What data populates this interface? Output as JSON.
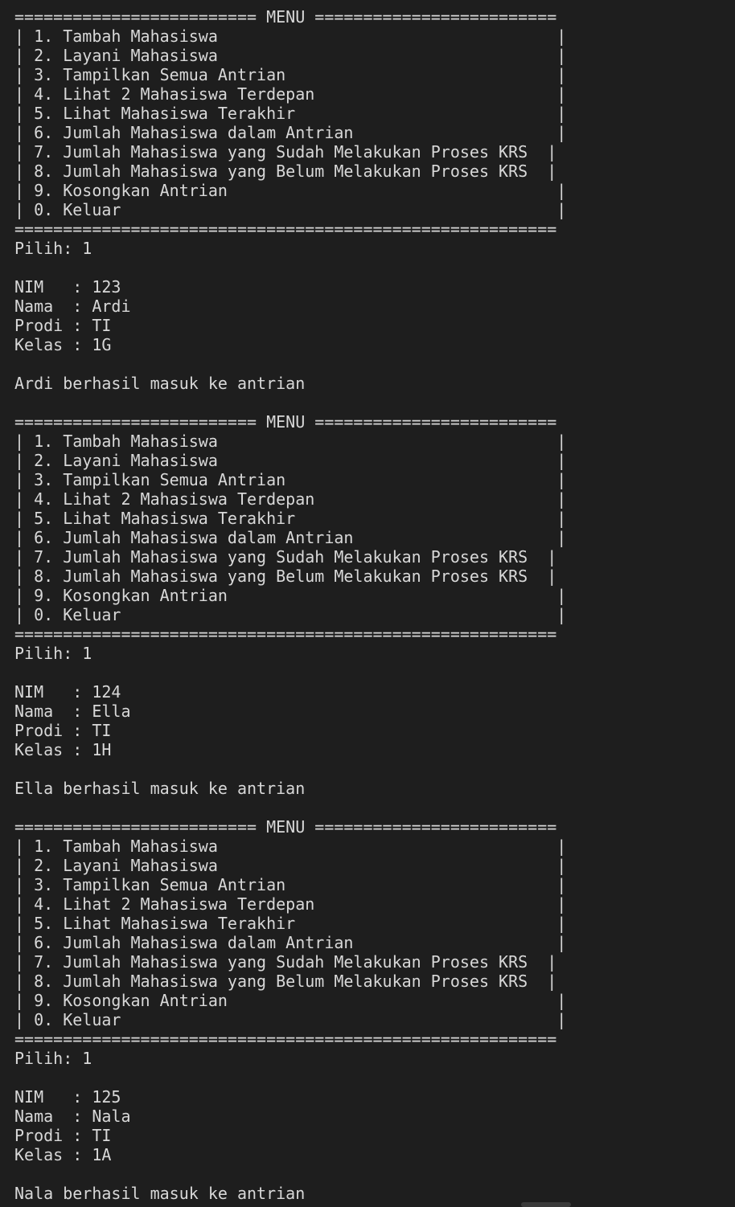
{
  "terminal": {
    "lines": [
      "========================= MENU =========================",
      "| 1. Tambah Mahasiswa                                   |",
      "| 2. Layani Mahasiswa                                   |",
      "| 3. Tampilkan Semua Antrian                            |",
      "| 4. Lihat 2 Mahasiswa Terdepan                         |",
      "| 5. Lihat Mahasiswa Terakhir                           |",
      "| 6. Jumlah Mahasiswa dalam Antrian                     |",
      "| 7. Jumlah Mahasiswa yang Sudah Melakukan Proses KRS  |",
      "| 8. Jumlah Mahasiswa yang Belum Melakukan Proses KRS  |",
      "| 9. Kosongkan Antrian                                  |",
      "| 0. Keluar                                             |",
      "========================================================",
      "Pilih: 1",
      "",
      "NIM   : 123",
      "Nama  : Ardi",
      "Prodi : TI",
      "Kelas : 1G",
      "",
      "Ardi berhasil masuk ke antrian",
      "",
      "========================= MENU =========================",
      "| 1. Tambah Mahasiswa                                   |",
      "| 2. Layani Mahasiswa                                   |",
      "| 3. Tampilkan Semua Antrian                            |",
      "| 4. Lihat 2 Mahasiswa Terdepan                         |",
      "| 5. Lihat Mahasiswa Terakhir                           |",
      "| 6. Jumlah Mahasiswa dalam Antrian                     |",
      "| 7. Jumlah Mahasiswa yang Sudah Melakukan Proses KRS  |",
      "| 8. Jumlah Mahasiswa yang Belum Melakukan Proses KRS  |",
      "| 9. Kosongkan Antrian                                  |",
      "| 0. Keluar                                             |",
      "========================================================",
      "Pilih: 1",
      "",
      "NIM   : 124",
      "Nama  : Ella",
      "Prodi : TI",
      "Kelas : 1H",
      "",
      "Ella berhasil masuk ke antrian",
      "",
      "========================= MENU =========================",
      "| 1. Tambah Mahasiswa                                   |",
      "| 2. Layani Mahasiswa                                   |",
      "| 3. Tampilkan Semua Antrian                            |",
      "| 4. Lihat 2 Mahasiswa Terdepan                         |",
      "| 5. Lihat Mahasiswa Terakhir                           |",
      "| 6. Jumlah Mahasiswa dalam Antrian                     |",
      "| 7. Jumlah Mahasiswa yang Sudah Melakukan Proses KRS  |",
      "| 8. Jumlah Mahasiswa yang Belum Melakukan Proses KRS  |",
      "| 9. Kosongkan Antrian                                  |",
      "| 0. Keluar                                             |",
      "========================================================",
      "Pilih: 1",
      "",
      "NIM   : 125",
      "Nama  : Nala",
      "Prodi : TI",
      "Kelas : 1A",
      "",
      "Nala berhasil masuk ke antrian"
    ]
  },
  "colors": {
    "background": "#1e1e1e",
    "text": "#d8d8d8"
  }
}
